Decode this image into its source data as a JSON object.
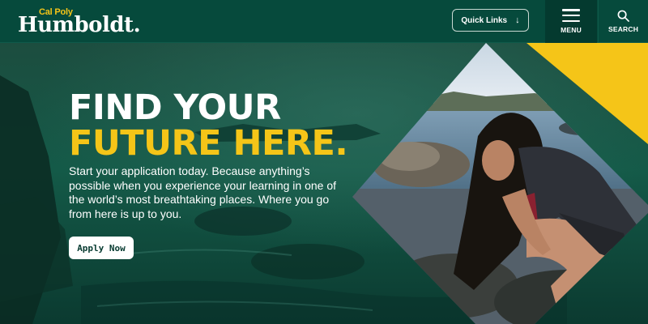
{
  "header": {
    "logo_top": "Cal Poly",
    "logo_main": "Humboldt.",
    "quick_links_label": "Quick Links",
    "menu_label": "MENU",
    "search_label": "SEARCH"
  },
  "hero": {
    "headline_line1": "FIND YOUR",
    "headline_line2": "FUTURE HERE.",
    "intro": "Start your application today. Because anything’s possible when you experience your learning in one of the world’s most breathtaking places. Where you go from here is up to you.",
    "cta_label": "Apply Now"
  },
  "colors": {
    "brand_green": "#064a3c",
    "brand_yellow": "#f5c518",
    "white": "#ffffff"
  },
  "icons": {
    "quick_links": "arrow-down-icon",
    "menu": "hamburger-icon",
    "search": "search-icon"
  }
}
